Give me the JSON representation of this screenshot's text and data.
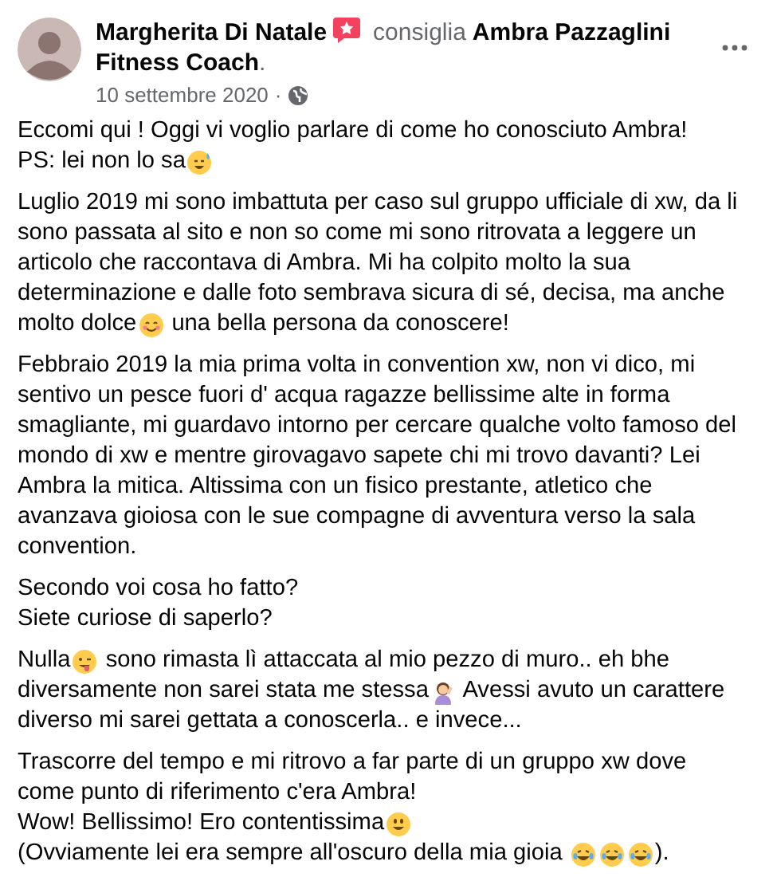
{
  "post": {
    "author": "Margherita Di Natale",
    "action": "consiglia",
    "page": [
      "Ambra Pazzaglini",
      "Fitness Coach"
    ],
    "page_suffix": ".",
    "date": "10 settembre 2020",
    "separator": "·"
  },
  "paragraphs": [
    [
      [
        {
          "kind": "text",
          "text": "Eccomi qui ! Oggi vi voglio parlare di come ho conosciuto Ambra!"
        }
      ],
      [
        {
          "kind": "text",
          "text": "PS: lei non lo sa"
        },
        {
          "kind": "grin-sweat"
        }
      ]
    ],
    [
      [
        {
          "kind": "text",
          "text": "Luglio 2019 mi sono imbattuta per caso sul gruppo ufficiale di xw, da li"
        }
      ],
      [
        {
          "kind": "text",
          "text": "sono passata al sito e non so come mi sono ritrovata a leggere un"
        }
      ],
      [
        {
          "kind": "text",
          "text": "articolo che raccontava di Ambra. Mi ha colpito molto la sua"
        }
      ],
      [
        {
          "kind": "text",
          "text": "determinazione e dalle foto sembrava sicura di sé, decisa, ma anche"
        }
      ],
      [
        {
          "kind": "text",
          "text": "molto dolce"
        },
        {
          "kind": "blush"
        },
        {
          "kind": "text",
          "text": " una bella persona da conoscere!"
        }
      ]
    ],
    [
      [
        {
          "kind": "text",
          "text": "Febbraio 2019 la mia prima volta in convention xw, non vi dico, mi"
        }
      ],
      [
        {
          "kind": "text",
          "text": "sentivo un pesce fuori d' acqua ragazze bellissime alte in forma"
        }
      ],
      [
        {
          "kind": "text",
          "text": "smagliante, mi guardavo intorno per cercare qualche volto famoso del"
        }
      ],
      [
        {
          "kind": "text",
          "text": "mondo di xw e mentre girovagavo sapete chi mi trovo davanti? Lei"
        }
      ],
      [
        {
          "kind": "text",
          "text": "Ambra la mitica. Altissima con un fisico prestante, atletico che"
        }
      ],
      [
        {
          "kind": "text",
          "text": "avanzava gioiosa con le sue compagne di avventura verso la sala"
        }
      ],
      [
        {
          "kind": "text",
          "text": "convention."
        }
      ]
    ],
    [
      [
        {
          "kind": "text",
          "text": "Secondo voi cosa ho fatto?"
        }
      ],
      [
        {
          "kind": "text",
          "text": "Siete curiose di saperlo?"
        }
      ]
    ],
    [
      [
        {
          "kind": "text",
          "text": "Nulla"
        },
        {
          "kind": "tongue"
        },
        {
          "kind": "text",
          "text": " sono rimasta lì attaccata al mio pezzo di muro.. eh bhe"
        }
      ],
      [
        {
          "kind": "text",
          "text": "diversamente non sarei stata me stessa"
        },
        {
          "kind": "figure"
        },
        {
          "kind": "text",
          "text": " Avessi avuto un carattere"
        }
      ],
      [
        {
          "kind": "text",
          "text": "diverso mi sarei gettata a conoscerla.. e invece..."
        }
      ]
    ],
    [
      [
        {
          "kind": "text",
          "text": "Trascorre del tempo e mi ritrovo a far parte di un gruppo xw dove"
        }
      ],
      [
        {
          "kind": "text",
          "text": "come punto di riferimento c'era Ambra!"
        }
      ],
      [
        {
          "kind": "text",
          "text": "Wow! Bellissimo! Ero contentissima"
        },
        {
          "kind": "smile"
        }
      ],
      [
        {
          "kind": "text",
          "text": "(Ovviamente lei era sempre all'oscuro della mia gioia "
        },
        {
          "kind": "laugh"
        },
        {
          "kind": "laugh"
        },
        {
          "kind": "laugh"
        },
        {
          "kind": "text",
          "text": ")."
        }
      ]
    ]
  ]
}
